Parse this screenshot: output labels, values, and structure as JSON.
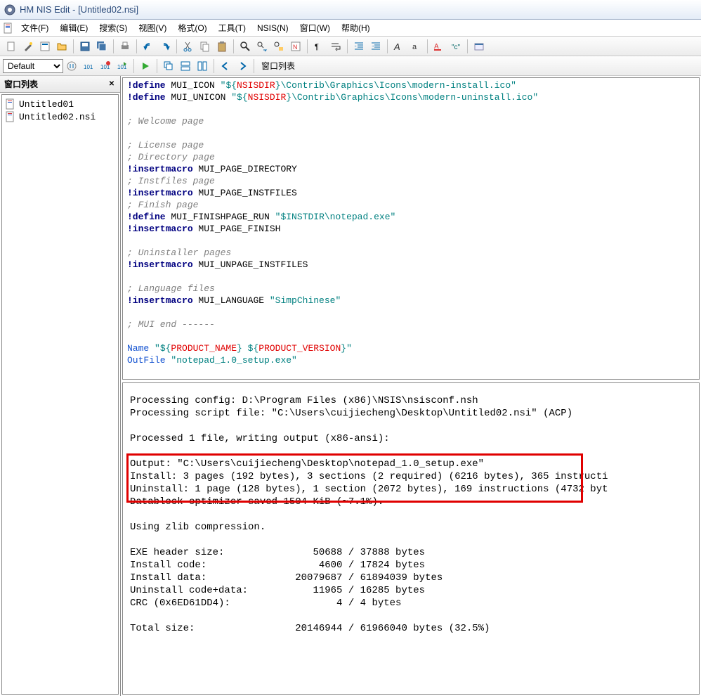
{
  "title": "HM NIS Edit - [Untitled02.nsi]",
  "menu": [
    "文件(F)",
    "编辑(E)",
    "搜索(S)",
    "视图(V)",
    "格式(O)",
    "工具(T)",
    "NSIS(N)",
    "窗口(W)",
    "帮助(H)"
  ],
  "toolbar2": {
    "dropdown": "Default",
    "label": "窗口列表"
  },
  "panel": {
    "title": "窗口列表",
    "files": [
      "Untitled01",
      "Untitled02.nsi"
    ]
  },
  "editor": {
    "l1a": "!define",
    "l1b": "MUI_ICON ",
    "l1c": "\"${",
    "l1d": "NSISDIR",
    "l1e": "}",
    "l1f": "\\Contrib\\Graphics\\Icons\\modern-install.ico",
    "l1g": "\"",
    "l2a": "!define",
    "l2b": "MUI_UNICON ",
    "l2c": "\"${",
    "l2d": "NSISDIR",
    "l2e": "}",
    "l2f": "\\Contrib\\Graphics\\Icons\\modern-uninstall.ico",
    "l2g": "\"",
    "c1": "; Welcome page",
    "c2": "; License page",
    "c3": "; Directory page",
    "l3a": "!insertmacro",
    "l3b": " MUI_PAGE_DIRECTORY",
    "c4": "; Instfiles page",
    "l4a": "!insertmacro",
    "l4b": " MUI_PAGE_INSTFILES",
    "c5": "; Finish page",
    "l5a": "!define",
    "l5b": "MUI_FINISHPAGE_RUN ",
    "l5c": "\"$INSTDIR",
    "l5d": "\\notepad.exe",
    "l5e": "\"",
    "l6a": "!insertmacro",
    "l6b": " MUI_PAGE_FINISH",
    "c6": "; Uninstaller pages",
    "l7a": "!insertmacro",
    "l7b": " MUI_UNPAGE_INSTFILES",
    "c7": "; Language files",
    "l8a": "!insertmacro",
    "l8b": " MUI_LANGUAGE ",
    "l8c": "\"SimpChinese\"",
    "c8": "; MUI end ------",
    "l9a": "Name ",
    "l9b": "\"${",
    "l9c": "PRODUCT_NAME",
    "l9d": "} ${",
    "l9e": "PRODUCT_VERSION",
    "l9f": "}\"",
    "l10a": "OutFile ",
    "l10b": "\"notepad_1.0_setup.exe\""
  },
  "output": {
    "l1": "Processing config: D:\\Program Files (x86)\\NSIS\\nsisconf.nsh",
    "l2": "Processing script file: \"C:\\Users\\cuijiecheng\\Desktop\\Untitled02.nsi\" (ACP)",
    "l3": "Processed 1 file, writing output (x86-ansi):",
    "l4": "Output: \"C:\\Users\\cuijiecheng\\Desktop\\notepad_1.0_setup.exe\"",
    "l5": "Install: 3 pages (192 bytes), 3 sections (2 required) (6216 bytes), 365 instructi",
    "l6": "Uninstall: 1 page (128 bytes), 1 section (2072 bytes), 169 instructions (4732 byt",
    "l7": "Datablock optimizer saved 1504 KiB (~7.1%).",
    "l8": "Using zlib compression.",
    "l9": "EXE header size:               50688 / 37888 bytes",
    "l10": "Install code:                   4600 / 17824 bytes",
    "l11": "Install data:               20079687 / 61894039 bytes",
    "l12": "Uninstall code+data:           11965 / 16285 bytes",
    "l13": "CRC (0x6ED61DD4):                  4 / 4 bytes",
    "l14": "Total size:                 20146944 / 61966040 bytes (32.5%)"
  }
}
